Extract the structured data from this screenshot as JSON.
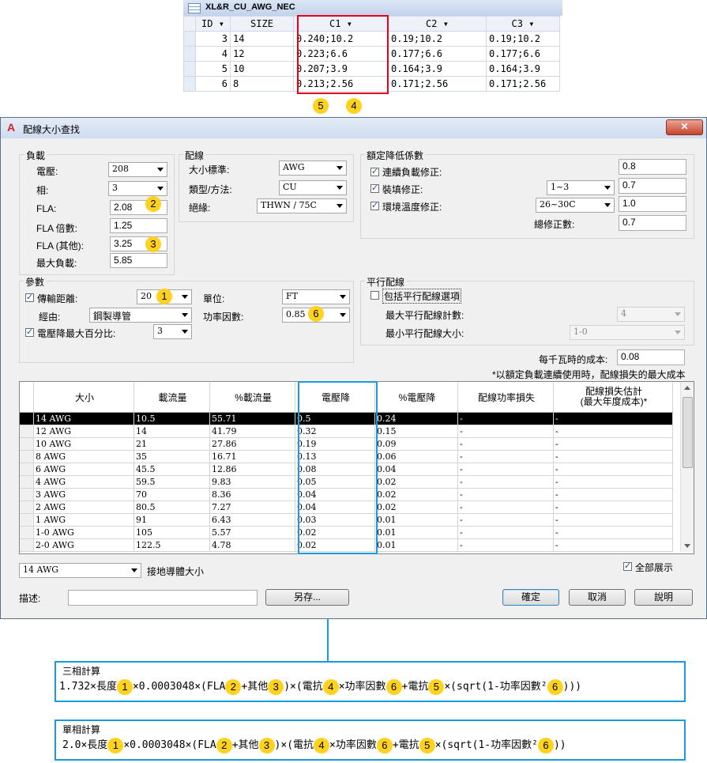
{
  "access_table": {
    "tab_label": "XL&R_CU_AWG_NEC",
    "headers": [
      "ID",
      "SIZE",
      "C1",
      "C2",
      "C3"
    ],
    "rows": [
      [
        "3",
        "14",
        "0.240;10.2",
        "0.19;10.2",
        "0.19;10.2"
      ],
      [
        "4",
        "12",
        "0.223;6.6",
        "0.177;6.6",
        "0.177;6.6"
      ],
      [
        "5",
        "10",
        "0.207;3.9",
        "0.164;3.9",
        "0.164;3.9"
      ],
      [
        "6",
        "8",
        "0.213;2.56",
        "0.171;2.56",
        "0.171;2.56"
      ]
    ],
    "callouts": [
      "5",
      "4"
    ]
  },
  "dialog": {
    "title": "配線大小查找",
    "load": {
      "group_title": "負載",
      "voltage_label": "電壓:",
      "voltage_value": "208",
      "phase_label": "相:",
      "phase_value": "3",
      "fla_label": "FLA:",
      "fla_value": "2.08",
      "fla_multiplier_label": "FLA 倍數:",
      "fla_multiplier_value": "1.25",
      "fla_other_label": "FLA (其他):",
      "fla_other_value": "3.25",
      "max_load_label": "最大負載:",
      "max_load_value": "5.85"
    },
    "wiring": {
      "group_title": "配線",
      "size_standard_label": "大小標準:",
      "size_standard_value": "AWG",
      "type_method_label": "類型/方法:",
      "type_method_value": "CU",
      "insulation_label": "絕緣:",
      "insulation_value": "THWN / 75C"
    },
    "derating": {
      "group_title": "額定降低係數",
      "continuous_label": "連續負載修正:",
      "continuous_value": "0.8",
      "fill_label": "裝填修正:",
      "fill_option": "1~3",
      "fill_value": "0.7",
      "ambient_label": "環境溫度修正:",
      "ambient_option": "26~30C",
      "ambient_value": "1.0",
      "total_label": "總修正數:",
      "total_value": "0.7"
    },
    "params": {
      "group_title": "參數",
      "distance_label": "傳輸距離:",
      "distance_value": "20",
      "unit_label": "單位:",
      "unit_value": "FT",
      "via_label": "經由:",
      "via_value": "鋼製導管",
      "pf_label": "功率因數:",
      "pf_value": "0.85",
      "vdrop_max_label": "電壓降最大百分比:",
      "vdrop_max_value": "3"
    },
    "parallel": {
      "group_title": "平行配線",
      "include_label": "包括平行配線選項",
      "max_count_label": "最大平行配線計數:",
      "max_count_value": "4",
      "min_size_label": "最小平行配線大小:",
      "min_size_value": "1-0"
    },
    "cost_label": "每千瓦時的成本:",
    "cost_value": "0.08",
    "cost_note": "*以額定負載連續使用時，配線損失的最大成本",
    "grid": {
      "headers": [
        "大小",
        "載流量",
        "%載流量",
        "電壓降",
        "%電壓降",
        "配線功率損失",
        "配線損失估計\n(最大年度成本)*"
      ],
      "rows": [
        [
          "14 AWG",
          "10.5",
          "55.71",
          "0.5",
          "0.24",
          "-",
          "-"
        ],
        [
          "12 AWG",
          "14",
          "41.79",
          "0.32",
          "0.15",
          "-",
          "-"
        ],
        [
          "10 AWG",
          "21",
          "27.86",
          "0.19",
          "0.09",
          "-",
          "-"
        ],
        [
          "8 AWG",
          "35",
          "16.71",
          "0.13",
          "0.06",
          "-",
          "-"
        ],
        [
          "6 AWG",
          "45.5",
          "12.86",
          "0.08",
          "0.04",
          "-",
          "-"
        ],
        [
          "4 AWG",
          "59.5",
          "9.83",
          "0.05",
          "0.02",
          "-",
          "-"
        ],
        [
          "3 AWG",
          "70",
          "8.36",
          "0.04",
          "0.02",
          "-",
          "-"
        ],
        [
          "2 AWG",
          "80.5",
          "7.27",
          "0.04",
          "0.02",
          "-",
          "-"
        ],
        [
          "1 AWG",
          "91",
          "6.43",
          "0.03",
          "0.01",
          "-",
          "-"
        ],
        [
          "1-0 AWG",
          "105",
          "5.57",
          "0.02",
          "0.01",
          "-",
          "-"
        ],
        [
          "2-0 AWG",
          "122.5",
          "4.78",
          "0.02",
          "0.01",
          "-",
          "-"
        ]
      ]
    },
    "ground_value": "14 AWG",
    "ground_label": "接地導體大小",
    "show_all_label": "全部展示",
    "desc_label": "描述:",
    "save_as_label": "另存...",
    "ok_label": "確定",
    "cancel_label": "取消",
    "help_label": "說明",
    "badges": [
      "2",
      "3",
      "1",
      "6"
    ]
  },
  "formulas": {
    "three_phase_title": "三相計算",
    "three_phase": [
      "1.732×長度",
      "1",
      "×0.0003048×(FLA",
      "2",
      "+其他",
      "3",
      ")×(電抗",
      "4",
      "×功率因數",
      "6",
      "+電抗",
      "5",
      "×(sqrt(1-功率因數²",
      "6",
      ")))"
    ],
    "single_phase_title": "單相計算",
    "single_phase": [
      "2.0×長度",
      "1",
      "×0.0003048×(FLA",
      "2",
      "+其他",
      "3",
      ")×(電抗",
      "4",
      "×功率因數",
      "6",
      "+電抗",
      "5",
      "×(sqrt(1-功率因數²",
      "6",
      "))"
    ]
  },
  "colors": {
    "highlight_red": "#e3001b",
    "highlight_blue": "#1a9ae0",
    "badge": "#ffd21f"
  }
}
